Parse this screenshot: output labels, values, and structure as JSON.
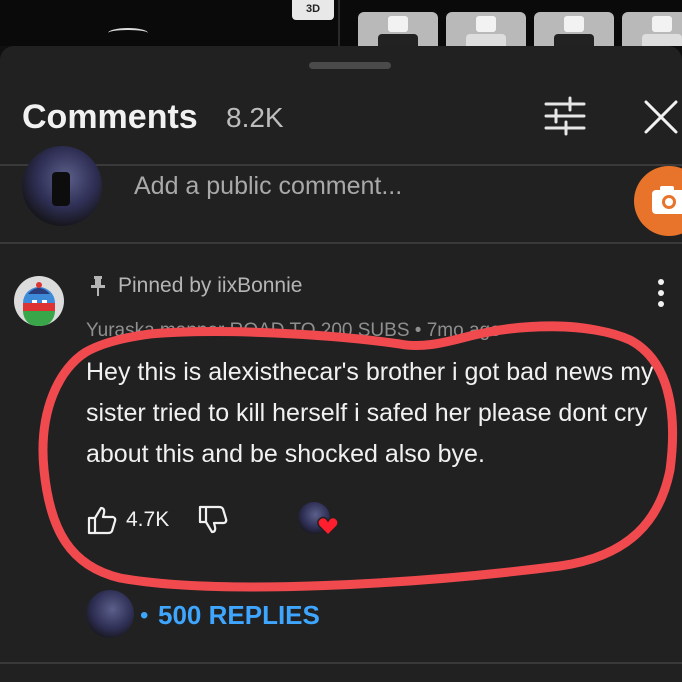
{
  "video_strip": {
    "badge": "3D"
  },
  "header": {
    "title": "Comments",
    "count": "8.2K"
  },
  "composer": {
    "placeholder": "Add a public comment..."
  },
  "comment": {
    "pinned_label": "Pinned by iixBonnie",
    "meta": "Yuraska manner ROAD TO 200 SUBS • 7mo ago",
    "text": "Hey this is alexisthecar's brother i got bad news my sister tried to kill herself i safed her please dont cry about this and be shocked also bye.",
    "likes": "4.7K",
    "replies_label": "500 REPLIES",
    "replies_dot": "•"
  },
  "colors": {
    "sheet_bg": "#212121",
    "link_blue": "#3ea6ff",
    "annotation_red": "#f04a4f",
    "camera_orange": "#e8732a"
  }
}
